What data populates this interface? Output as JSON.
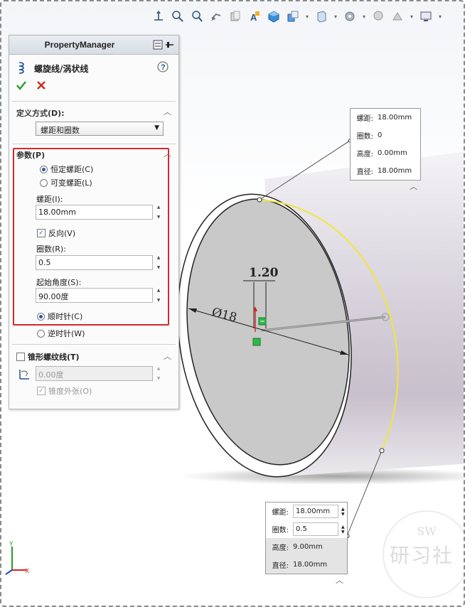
{
  "toolbar": {
    "icons": [
      "view-orientation-icon",
      "zoom-to-fit-icon",
      "zoom-area-icon",
      "previous-view-icon",
      "section-view-icon",
      "dynamic-annotation-icon",
      "view-cube-icon",
      "display-style-icon",
      "hide-show-icon",
      "edit-appearance-icon",
      "apply-scene-icon",
      "view-settings-icon",
      "display-icon"
    ]
  },
  "pm": {
    "title": "PropertyManager",
    "feature_title": "螺旋线/涡状线",
    "define_section": {
      "title": "定义方式(D):",
      "dropdown_value": "螺距和圈数"
    },
    "params_section": {
      "title": "参数(P)",
      "constant_pitch": "恒定螺距(C)",
      "variable_pitch": "可变螺距(L)",
      "pitch_label": "螺距(I):",
      "pitch_value": "18.00mm",
      "reverse_label": "反向(V)",
      "revolutions_label": "圈数(R):",
      "revolutions_value": "0.5",
      "start_angle_label": "起始角度(S):",
      "start_angle_value": "90.00度",
      "clockwise": "顺时针(C)",
      "counterclockwise": "逆时针(W)"
    },
    "taper_section": {
      "title": "锥形螺纹线(T)",
      "angle_value": "0.00度",
      "taper_outward": "锥度外张(O)"
    }
  },
  "viewport": {
    "dim_pitch_text": "1.20",
    "dim_diameter_text": "Ø18",
    "callout_top": {
      "pitch_label": "螺距:",
      "pitch_value": "18.00mm",
      "rev_label": "圈数:",
      "rev_value": "0",
      "height_label": "高度:",
      "height_value": "0.00mm",
      "diameter_label": "直径:",
      "diameter_value": "18.00mm"
    },
    "callout_bottom": {
      "pitch_label": "螺距:",
      "pitch_value": "18.00mm",
      "rev_label": "圈数:",
      "rev_value": "0.5",
      "height_label": "高度:",
      "height_value": "9.00mm",
      "diameter_label": "直径:",
      "diameter_value": "18.00mm"
    },
    "triad": {
      "y_label": "Y",
      "x_label": "X"
    },
    "watermark": {
      "top": "SW",
      "main": "研习社"
    }
  },
  "colors": {
    "accent_red": "#d9262a",
    "ok_green": "#2f9a2f",
    "helix_yellow": "#f2e63a"
  }
}
